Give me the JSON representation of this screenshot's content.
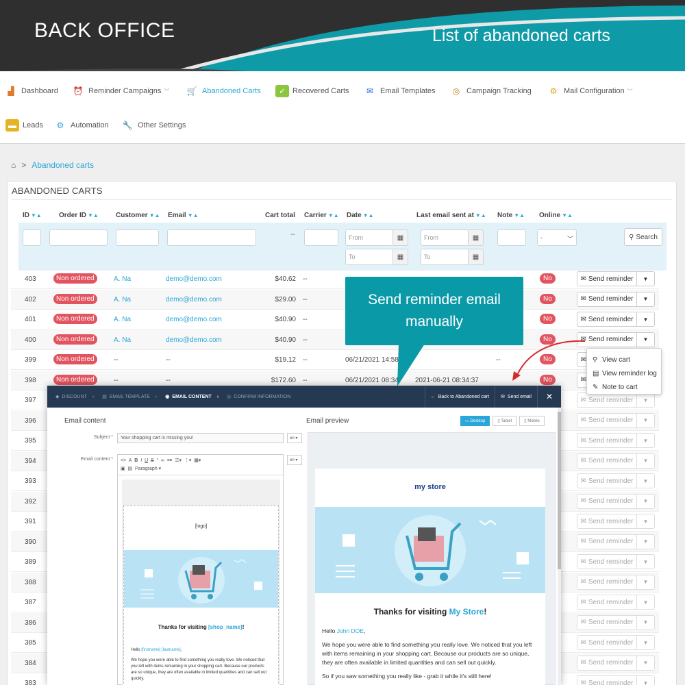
{
  "banner": {
    "left_title": "BACK OFFICE",
    "right_title": "List of abandoned carts"
  },
  "nav": {
    "items": [
      {
        "label": "Dashboard",
        "icon": "chart-icon"
      },
      {
        "label": "Reminder Campaigns",
        "icon": "alarm-clock-icon"
      },
      {
        "label": "Abandoned Carts",
        "icon": "cart-icon"
      },
      {
        "label": "Recovered Carts",
        "icon": "bag-icon"
      },
      {
        "label": "Email Templates",
        "icon": "email-template-icon"
      },
      {
        "label": "Campaign Tracking",
        "icon": "tracking-icon"
      },
      {
        "label": "Mail Configuration",
        "icon": "mail-config-icon"
      },
      {
        "label": "Leads",
        "icon": "leads-icon"
      },
      {
        "label": "Automation",
        "icon": "gears-icon"
      },
      {
        "label": "Other Settings",
        "icon": "wrench-icon"
      }
    ]
  },
  "breadcrumb": {
    "sep": ">",
    "current": "Abandoned carts"
  },
  "panel": {
    "title": "ABANDONED CARTS"
  },
  "columns": [
    "ID",
    "Order ID",
    "Customer",
    "Email",
    "Cart total",
    "Carrier",
    "Date",
    "Last email sent at",
    "Note",
    "Online"
  ],
  "filters": {
    "from": "From",
    "to": "To",
    "cart_total_dash": "--",
    "online_select": "-",
    "search": "Search"
  },
  "rows": [
    {
      "id": "403",
      "order": "Non ordered",
      "customer": "A. Na",
      "email": "demo@demo.com",
      "total": "$40.62",
      "carrier": "--",
      "date": "",
      "last": "",
      "note": "",
      "online": "No"
    },
    {
      "id": "402",
      "order": "Non ordered",
      "customer": "A. Na",
      "email": "demo@demo.com",
      "total": "$29.00",
      "carrier": "--",
      "date": "",
      "last": "",
      "note": "",
      "online": "No"
    },
    {
      "id": "401",
      "order": "Non ordered",
      "customer": "A. Na",
      "email": "demo@demo.com",
      "total": "$40.90",
      "carrier": "--",
      "date": "",
      "last": "",
      "note": "",
      "online": "No"
    },
    {
      "id": "400",
      "order": "Non ordered",
      "customer": "A. Na",
      "email": "demo@demo.com",
      "total": "$40.90",
      "carrier": "--",
      "date": "",
      "last": "",
      "note": "",
      "online": "No"
    },
    {
      "id": "399",
      "order": "Non ordered",
      "customer": "--",
      "email": "--",
      "total": "$19.12",
      "carrier": "--",
      "date": "06/21/2021 14:58:13",
      "last": "",
      "note": "--",
      "online": "No"
    },
    {
      "id": "398",
      "order": "Non ordered",
      "customer": "--",
      "email": "--",
      "total": "$172.60",
      "carrier": "--",
      "date": "06/21/2021 08:34:",
      "last": "2021-06-21 08:34:37",
      "note": "",
      "online": "No"
    }
  ],
  "faded_ids": [
    "397",
    "396",
    "395",
    "394",
    "393",
    "392",
    "391",
    "390",
    "389",
    "388",
    "387",
    "386",
    "385",
    "384",
    "383"
  ],
  "send_reminder": "Send reminder",
  "dropdown": {
    "items": [
      "View cart",
      "View reminder log",
      "Note to cart"
    ]
  },
  "callout": {
    "line1": "Send reminder email",
    "line2": "manually"
  },
  "modal": {
    "steps": [
      "DISCOUNT",
      "EMAIL TEMPLATE",
      "EMAIL CONTENT",
      "CONFIRM INFORMATION"
    ],
    "back": "Back to Abandoned cart",
    "send": "Send email",
    "close": "✕",
    "content_title": "Email content",
    "preview_title": "Email preview",
    "subject_label": "Subject",
    "subject_value": "Your shopping cart is missing you!",
    "content_label": "Email content",
    "lang": "en",
    "paragraph": "Paragraph",
    "tabs": [
      "Desktop",
      "Tablet",
      "Mobile"
    ],
    "editor": {
      "logo": "[logo]",
      "thanks_prefix": "Thanks for visiting ",
      "shop_tag": "[shop_name]",
      "thanks_suffix": "!",
      "hello_prefix": "Hello ",
      "firstname": "[firstname]",
      "lastname": "[lastname]",
      "hello_suffix": ",",
      "body": "We hope you were able to find something you really love. We noticed that you left with items remaining in your shopping cart. Because our products are so unique, they are often available in limited quantities and can sell out quickly."
    },
    "preview": {
      "store_logo": "my store",
      "thanks_prefix": "Thanks for visiting ",
      "store_name": "My Store",
      "thanks_suffix": "!",
      "hello_prefix": "Hello ",
      "customer": "John DOE",
      "hello_suffix": ",",
      "body": "We hope you were able to find something you really love. We noticed that you left with items remaining in your shopping cart. Because our products are so unique, they are often available in limited quantities and can sell out quickly.",
      "body2": "So if you saw something you really like - grab it while it's still here!"
    }
  },
  "colors": {
    "accent": "#2aa6d8",
    "teal": "#0a9aa7",
    "badge": "#e2545f",
    "modal_header": "#253a52"
  }
}
